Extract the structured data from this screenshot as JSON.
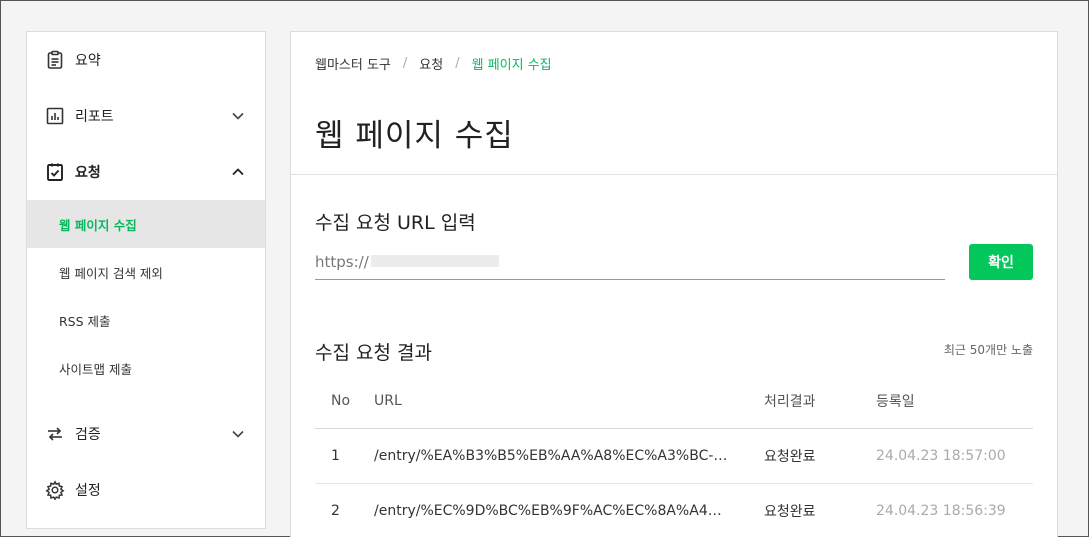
{
  "sidebar": {
    "items": [
      {
        "label": "요약"
      },
      {
        "label": "리포트"
      },
      {
        "label": "요청"
      },
      {
        "label": "검증"
      },
      {
        "label": "설정"
      }
    ],
    "sub_items": [
      {
        "label": "웹 페이지 수집"
      },
      {
        "label": "웹 페이지 검색 제외"
      },
      {
        "label": "RSS 제출"
      },
      {
        "label": "사이트맵 제출"
      }
    ]
  },
  "breadcrumb": {
    "items": [
      "웹마스터 도구",
      "요청"
    ],
    "current": "웹 페이지 수집",
    "separator": "/"
  },
  "page_title": "웹 페이지 수집",
  "url_section": {
    "title": "수집 요청 URL 입력",
    "input_value": "https://",
    "button_label": "확인"
  },
  "results": {
    "title": "수집 요청 결과",
    "note": "최근 50개만 노출",
    "columns": [
      "No",
      "URL",
      "처리결과",
      "등록일"
    ],
    "rows": [
      {
        "no": "1",
        "url": "/entry/%EA%B3%B5%EB%AA%A8%EC%A3%BC-…",
        "result": "요청완료",
        "date": "24.04.23 18:57:00"
      },
      {
        "no": "2",
        "url": "/entry/%EC%9D%BC%EB%9F%AC%EC%8A%A4…",
        "result": "요청완료",
        "date": "24.04.23 18:56:39"
      }
    ]
  },
  "colors": {
    "accent": "#03c75a",
    "active_text": "#09b75f"
  }
}
